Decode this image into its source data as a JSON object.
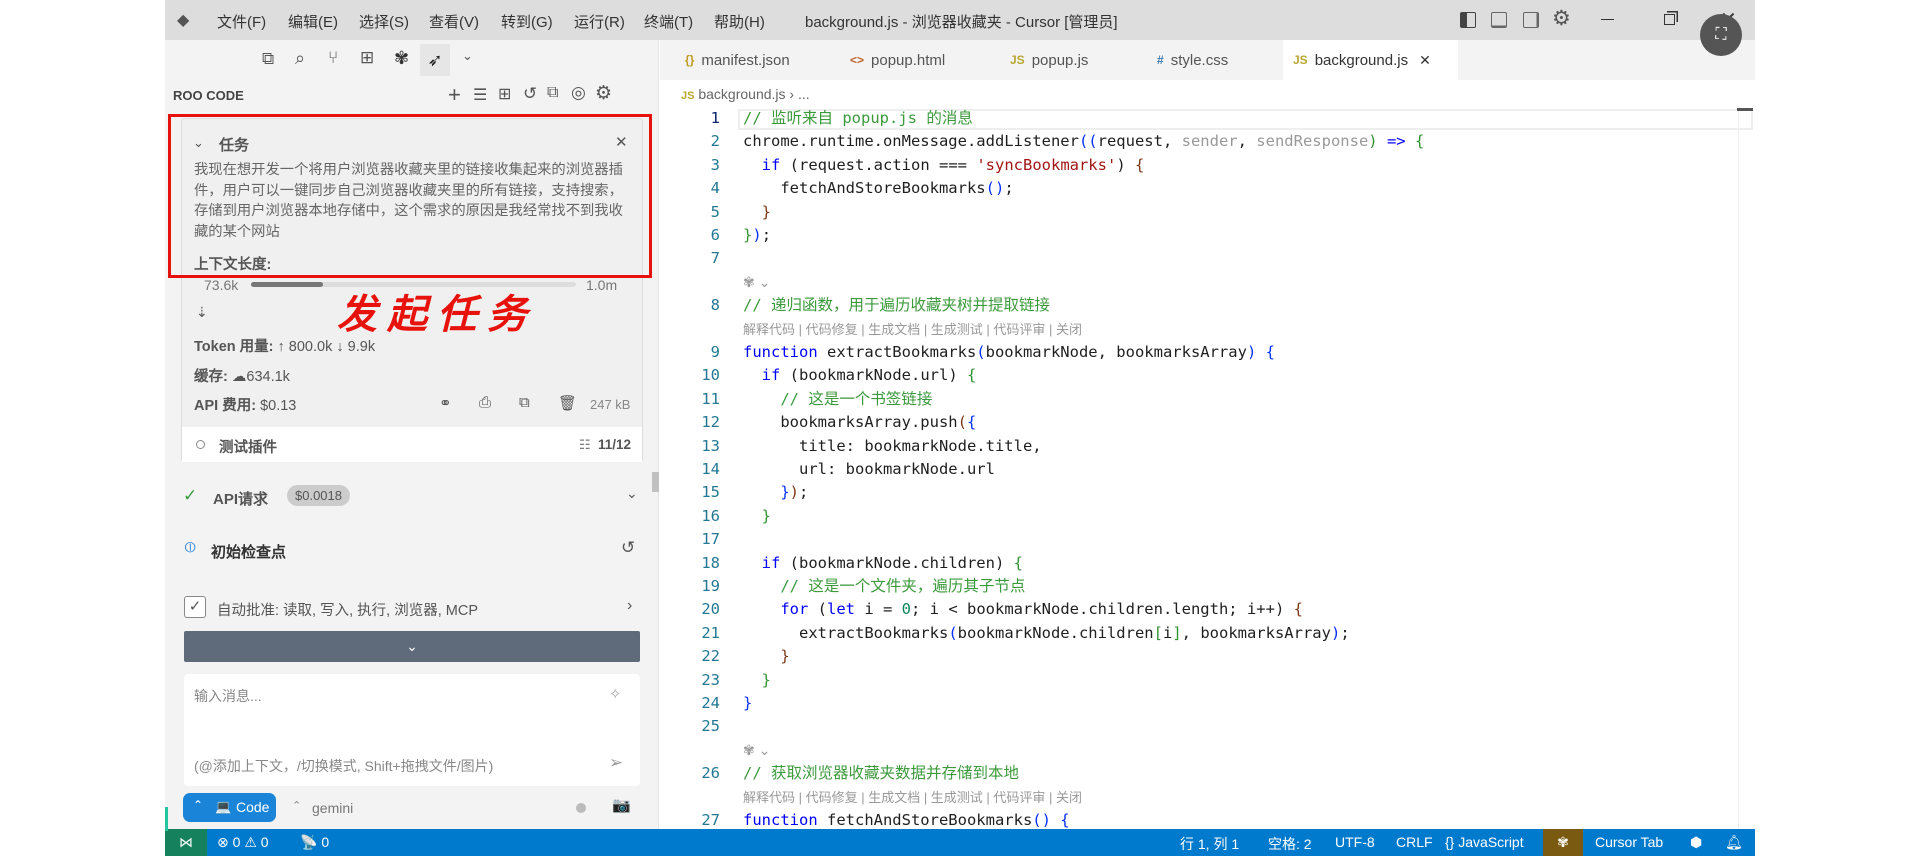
{
  "titlebar": {
    "menus": [
      "文件(F)",
      "编辑(E)",
      "选择(S)",
      "查看(V)",
      "转到(G)",
      "运行(R)",
      "终端(T)",
      "帮助(H)"
    ],
    "title": "background.js - 浏览器收藏夹 - Cursor [管理员]"
  },
  "sidebar": {
    "header": "ROO CODE",
    "task": {
      "heading": "任务",
      "description": "我现在想开发一个将用户浏览器收藏夹里的链接收集起来的浏览器插件，用户可以一键同步自己浏览器收藏夹里的所有链接，支持搜索，存储到用户浏览器本地存储中，这个需求的原因是我经常找不到我收藏的某个网站",
      "context_label": "上下文长度:",
      "context_used": "73.6k",
      "context_max": "1.0m",
      "context_fraction": 0.074,
      "token_label": "Token 用量:",
      "token_up": "800.0k",
      "token_down": "9.9k",
      "cache_label": "缓存:",
      "cache_value": "634.1k",
      "cost_label": "API 费用:",
      "cost_value": "$0.13",
      "size": "247 kB",
      "todo_label": "测试插件",
      "todo_count": "11/12"
    },
    "annotation": "发起任务",
    "api_request": {
      "label": "API请求",
      "cost": "$0.0018"
    },
    "checkpoint": "初始检查点",
    "auto_approve": "自动批准: 读取, 写入, 执行, 浏览器, MCP",
    "input": {
      "placeholder": "输入消息...",
      "hint": "(@添加上下文，/切换模式, Shift+拖拽文件/图片)"
    },
    "mode": "Code",
    "model": "gemini"
  },
  "editor": {
    "tabs": [
      {
        "icon": "{}",
        "label": "manifest.json",
        "color": "#c09a20"
      },
      {
        "icon": "<>",
        "label": "popup.html",
        "color": "#c0622a"
      },
      {
        "icon": "JS",
        "label": "popup.js",
        "color": "#b8a830"
      },
      {
        "icon": "#",
        "label": "style.css",
        "color": "#3a7ab0"
      },
      {
        "icon": "JS",
        "label": "background.js",
        "color": "#b8a830"
      }
    ],
    "breadcrumb": {
      "file": "background.js",
      "rest": "..."
    },
    "lens_text": "解释代码 | 代码修复 | 生成文档 | 生成测试 | 代码评审 | 关闭",
    "lines": [
      {
        "n": "1",
        "t": [
          [
            "c",
            "// 监听来自 popup.js 的消息"
          ]
        ]
      },
      {
        "n": "2",
        "t": [
          [
            "",
            "chrome.runtime.onMessage.addListener"
          ],
          [
            "b1",
            "(("
          ],
          [
            "",
            "request, "
          ],
          [
            "p",
            "sender"
          ],
          [
            "",
            ", "
          ],
          [
            "p",
            "sendResponse"
          ],
          [
            "b2",
            ")"
          ],
          [
            "k",
            " =>"
          ],
          [
            "b2",
            " {"
          ]
        ]
      },
      {
        "n": "3",
        "t": [
          [
            "",
            "  "
          ],
          [
            "k",
            "if"
          ],
          [
            "",
            " ("
          ],
          [
            "",
            "request.action === "
          ],
          [
            "s",
            "'syncBookmarks'"
          ],
          [
            "",
            ") "
          ],
          [
            "b3",
            "{"
          ]
        ]
      },
      {
        "n": "4",
        "t": [
          [
            "",
            "    fetchAndStoreBookmarks"
          ],
          [
            "b1",
            "()"
          ],
          [
            "",
            ";"
          ]
        ]
      },
      {
        "n": "5",
        "t": [
          [
            "",
            "  "
          ],
          [
            "b3",
            "}"
          ]
        ]
      },
      {
        "n": "6",
        "t": [
          [
            "b2",
            "}"
          ],
          [
            "b1",
            ")"
          ],
          [
            "",
            ";"
          ]
        ]
      },
      {
        "n": "7",
        "t": []
      },
      {
        "icon": true
      },
      {
        "n": "8",
        "t": [
          [
            "c",
            "// 递归函数，用于遍历收藏夹树并提取链接"
          ]
        ]
      },
      {
        "lens": true
      },
      {
        "n": "9",
        "t": [
          [
            "k",
            "function"
          ],
          [
            "",
            " extractBookmarks"
          ],
          [
            "b1",
            "("
          ],
          [
            "",
            "bookmarkNode, bookmarksArray"
          ],
          [
            "b1",
            ")"
          ],
          [
            "b1",
            " {"
          ]
        ]
      },
      {
        "n": "10",
        "t": [
          [
            "",
            "  "
          ],
          [
            "k",
            "if"
          ],
          [
            "",
            " ("
          ],
          [
            "",
            "bookmarkNode.url) "
          ],
          [
            "b2",
            "{"
          ]
        ]
      },
      {
        "n": "11",
        "t": [
          [
            "",
            "    "
          ],
          [
            "c",
            "// 这是一个书签链接"
          ]
        ]
      },
      {
        "n": "12",
        "t": [
          [
            "",
            "    bookmarksArray.push"
          ],
          [
            "b3",
            "("
          ],
          [
            "b1",
            "{"
          ]
        ]
      },
      {
        "n": "13",
        "t": [
          [
            "",
            "      title: bookmarkNode.title,"
          ]
        ]
      },
      {
        "n": "14",
        "t": [
          [
            "",
            "      url: bookmarkNode.url"
          ]
        ]
      },
      {
        "n": "15",
        "t": [
          [
            "",
            "    "
          ],
          [
            "b1",
            "}"
          ],
          [
            "b3",
            ")"
          ],
          [
            "",
            ";"
          ]
        ]
      },
      {
        "n": "16",
        "t": [
          [
            "",
            "  "
          ],
          [
            "b2",
            "}"
          ]
        ]
      },
      {
        "n": "17",
        "t": []
      },
      {
        "n": "18",
        "t": [
          [
            "",
            "  "
          ],
          [
            "k",
            "if"
          ],
          [
            "",
            " (bookmarkNode.children) "
          ],
          [
            "b2",
            "{"
          ]
        ]
      },
      {
        "n": "19",
        "t": [
          [
            "",
            "    "
          ],
          [
            "c",
            "// 这是一个文件夹，遍历其子节点"
          ]
        ]
      },
      {
        "n": "20",
        "t": [
          [
            "",
            "    "
          ],
          [
            "k",
            "for"
          ],
          [
            "",
            " ("
          ],
          [
            "k",
            "let"
          ],
          [
            "",
            " i = "
          ],
          [
            "n",
            "0"
          ],
          [
            "",
            "; i < bookmarkNode.children.length; i++) "
          ],
          [
            "b3",
            "{"
          ]
        ]
      },
      {
        "n": "21",
        "t": [
          [
            "",
            "      extractBookmarks"
          ],
          [
            "b1",
            "("
          ],
          [
            "",
            "bookmarkNode.children"
          ],
          [
            "b2",
            "["
          ],
          [
            "",
            "i"
          ],
          [
            "b2",
            "]"
          ],
          [
            "",
            ", bookmarksArray"
          ],
          [
            "b1",
            ")"
          ],
          [
            "",
            ";"
          ]
        ]
      },
      {
        "n": "22",
        "t": [
          [
            "",
            "    "
          ],
          [
            "b3",
            "}"
          ]
        ]
      },
      {
        "n": "23",
        "t": [
          [
            "",
            "  "
          ],
          [
            "b2",
            "}"
          ]
        ]
      },
      {
        "n": "24",
        "t": [
          [
            "b1",
            "}"
          ]
        ]
      },
      {
        "n": "25",
        "t": []
      },
      {
        "icon": true
      },
      {
        "n": "26",
        "t": [
          [
            "c",
            "// 获取浏览器收藏夹数据并存储到本地"
          ]
        ]
      },
      {
        "lens": true
      },
      {
        "n": "27",
        "t": [
          [
            "k",
            "function"
          ],
          [
            "",
            " fetchAndStoreBookmarks"
          ],
          [
            "b1",
            "()"
          ],
          [
            "b1",
            " {"
          ]
        ]
      }
    ]
  },
  "statusbar": {
    "errors": "0",
    "warnings": "0",
    "ports": "0",
    "position": "行 1, 列 1",
    "spaces": "空格: 2",
    "encoding": "UTF-8",
    "eol": "CRLF",
    "language": "JavaScript",
    "cursor_tab": "Cursor Tab"
  },
  "colors": {
    "accent": "#007acc",
    "annotation": "#e8120c",
    "remote": "#16825d"
  }
}
